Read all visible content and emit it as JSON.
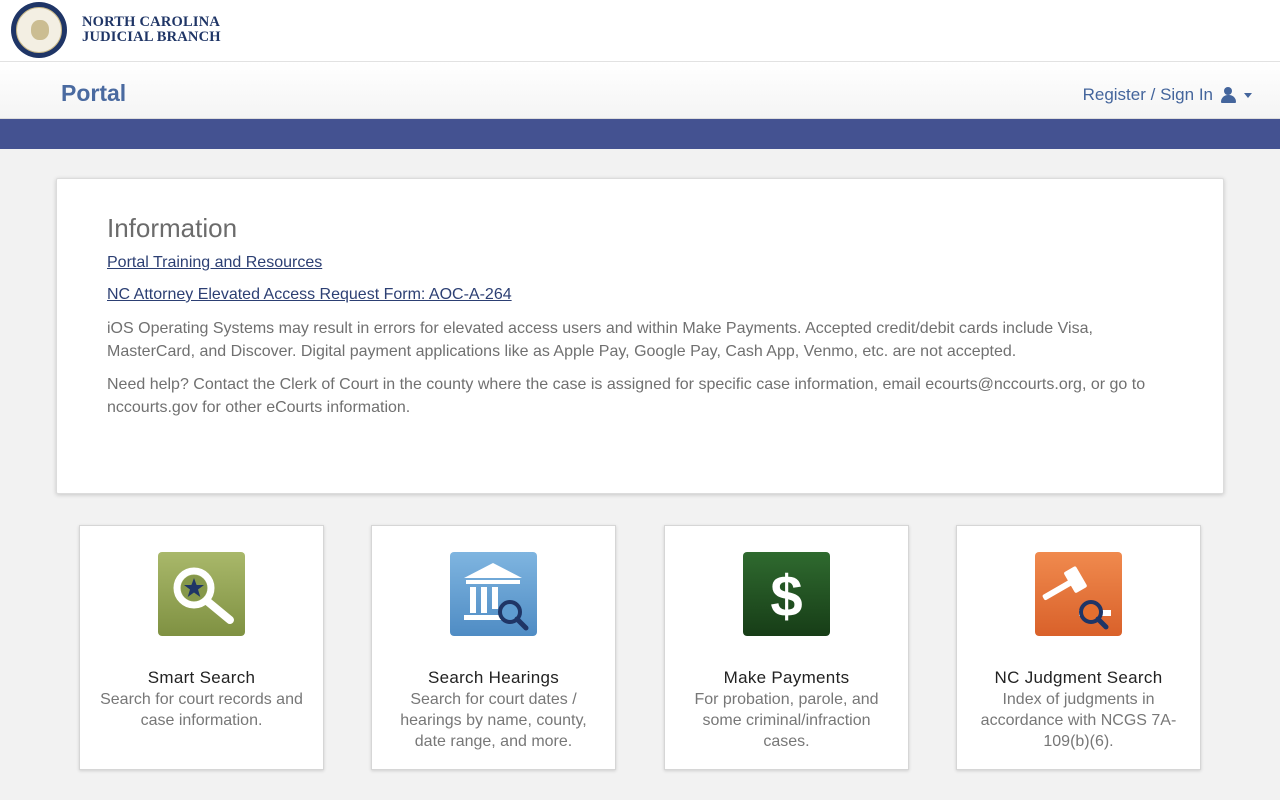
{
  "header": {
    "brand_line1": "NORTH CAROLINA",
    "brand_line2": "JUDICIAL BRANCH",
    "portal_title": "Portal",
    "signin_label": "Register / Sign In"
  },
  "info": {
    "title": "Information",
    "link1": "Portal Training and Resources",
    "link2": "NC Attorney Elevated Access Request Form: AOC-A-264",
    "para1": "iOS Operating Systems may result in errors for elevated access users and within Make Payments. Accepted credit/debit cards include Visa, MasterCard, and Discover. Digital payment applications like as Apple Pay, Google Pay, Cash App, Venmo, etc. are not accepted.",
    "para2": "Need help? Contact the Clerk of Court in the county where the case is assigned for specific case information, email ecourts@nccourts.org, or go to nccourts.gov for other eCourts information."
  },
  "tiles": [
    {
      "title": "Smart Search",
      "desc": "Search for court records and case information.",
      "icon": "magnifier-star-icon",
      "color": "#86984a"
    },
    {
      "title": "Search Hearings",
      "desc": "Search for court dates / hearings by name, county, date range, and more.",
      "icon": "courthouse-search-icon",
      "color": "#5e9bd0"
    },
    {
      "title": "Make Payments",
      "desc": "For probation, parole, and some criminal/infraction cases.",
      "icon": "dollar-icon",
      "color": "#1f4a1f"
    },
    {
      "title": "NC Judgment Search",
      "desc": "Index of judgments in accordance with NCGS 7A-109(b)(6).",
      "icon": "gavel-search-icon",
      "color": "#e56f2e"
    }
  ],
  "colors": {
    "brand_navy": "#1f3566",
    "portal_blue": "#4a6aa0",
    "band_blue": "#445291",
    "link_navy": "#2c3f73"
  }
}
